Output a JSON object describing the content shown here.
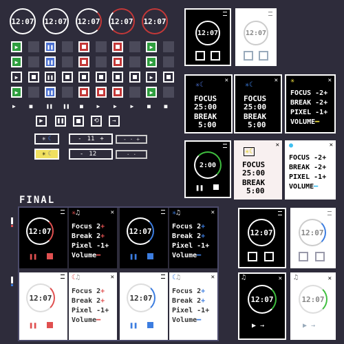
{
  "top_timers": [
    "12:07",
    "12:07",
    "12:07",
    "12:07",
    "12:07"
  ],
  "colors": {
    "bg": "#2e2c3b",
    "green": "#2f9e3f",
    "blue": "#4a6fd0",
    "red": "#c43838",
    "grey": "#4b4a5a",
    "accent_red": "#e05050",
    "accent_blue": "#3c7de0",
    "yellow": "#f0e040"
  },
  "panels": {
    "focus_label": "FOCUS",
    "focus_time": "25:00",
    "break_label": "BREAK",
    "break_time": "5:00",
    "small_timer": "2:00",
    "mini_timer": "12:07"
  },
  "settings": {
    "focus": "Focus",
    "break": "Break",
    "pixel": "Pixel",
    "volume": "Volume",
    "focus_val": "2",
    "break_val": "2",
    "pixel_val": "1",
    "plus": "+",
    "minus": "-"
  },
  "stepper": {
    "value_a": "11",
    "value_b": "12"
  },
  "final": {
    "label": "FINAL",
    "timer": "12:07"
  },
  "icons": [
    "play-icon",
    "pause-icon",
    "stop-icon",
    "repeat-icon",
    "arrow-icon",
    "sun-icon",
    "moon-icon",
    "music-icon",
    "close-icon",
    "menu-icon"
  ]
}
